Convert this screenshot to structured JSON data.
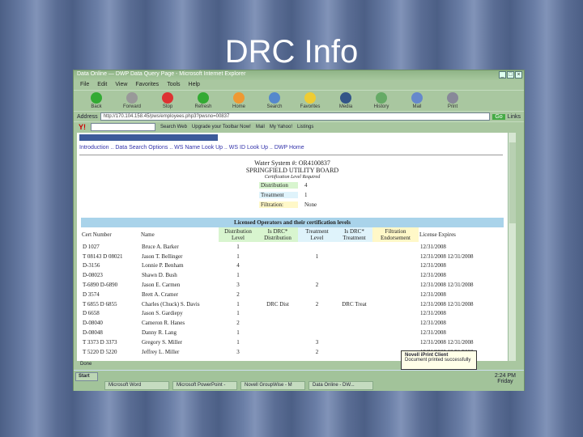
{
  "slide_title": "DRC Info",
  "window": {
    "title": "Data Online — DWP Data Query Page - Microsoft Internet Explorer",
    "menu": [
      "File",
      "Edit",
      "View",
      "Favorites",
      "Tools",
      "Help"
    ],
    "toolbar": [
      "Back",
      "Forward",
      "Stop",
      "Refresh",
      "Home",
      "Search",
      "Favorites",
      "Media",
      "History",
      "Mail",
      "Print"
    ],
    "address_label": "Address",
    "address": "http://170.104.158.45/pws/employees.php3?pwsno=00837",
    "go": "Go",
    "links": "Links",
    "yahoo": {
      "search_web": "Search Web",
      "upgrade": "Upgrade your Toolbar Now!",
      "mail": "Mail",
      "my_yahoo": "My Yahoo!",
      "listings": "Listings"
    },
    "status": "Done"
  },
  "page": {
    "nav": "Introduction .. Data Search Options .. WS Name Look Up .. WS ID Look Up .. DWP Home",
    "water_system": "Water System #: OR4100837",
    "name": "SPRINGFIELD UTILITY BOARD",
    "cert_required": "Certification Level Required",
    "requirements": [
      {
        "label": "Distribution",
        "value": "4",
        "color": "#d8f5cf"
      },
      {
        "label": "Treatment",
        "value": "1",
        "color": "#dff3fb"
      },
      {
        "label": "Filtration:",
        "value": "None",
        "color": "#fff8c8"
      }
    ],
    "table_caption": "Licensed Operators and their certification levels",
    "headers": [
      "Cert Number",
      "Name",
      "Distribution Level",
      "Is DRC* Distribution",
      "Treatment Level",
      "Is DRC* Treatment",
      "Filtration Endorsement",
      "License Expires"
    ],
    "rows": [
      [
        "D 1027",
        "Bruce A. Barker",
        "1",
        "",
        "",
        "",
        "",
        "12/31/2008"
      ],
      [
        "T 08143 D 08021",
        "Jason T. Bellinger",
        "1",
        "",
        "1",
        "",
        "",
        "12/31/2008 12/31/2008"
      ],
      [
        "D-3156",
        "Lonnie P. Benham",
        "4",
        "",
        "",
        "",
        "",
        "12/31/2008"
      ],
      [
        "D-08023",
        "Shawn D. Bush",
        "1",
        "",
        "",
        "",
        "",
        "12/31/2008"
      ],
      [
        "T-6890 D-6890",
        "Jason E. Carmen",
        "3",
        "",
        "2",
        "",
        "",
        "12/31/2008 12/31/2008"
      ],
      [
        "D 3574",
        "Brett A. Cramer",
        "2",
        "",
        "",
        "",
        "",
        "12/31/2008"
      ],
      [
        "T 6855 D 6855",
        "Charles (Chuck) S. Davis",
        "1",
        "DRC Dist",
        "2",
        "DRC Treat",
        "",
        "12/31/2008 12/31/2008"
      ],
      [
        "D 6658",
        "Jason S. Gardiepy",
        "1",
        "",
        "",
        "",
        "",
        "12/31/2008"
      ],
      [
        "D-08040",
        "Cameron R. Hanes",
        "2",
        "",
        "",
        "",
        "",
        "12/31/2008"
      ],
      [
        "D-08048",
        "Danny R. Lang",
        "1",
        "",
        "",
        "",
        "",
        "12/31/2008"
      ],
      [
        "T 3373 D 3373",
        "Gregory S. Miller",
        "1",
        "",
        "3",
        "",
        "",
        "12/31/2008 12/31/2008"
      ],
      [
        "T 5220 D 5220",
        "Jeffrey L. Miller",
        "3",
        "",
        "2",
        "",
        "",
        "12/31/2008 12/31/2008"
      ]
    ]
  },
  "balloon": {
    "title": "Novell iPrint Client",
    "text": "Document printed successfully"
  },
  "taskbar": {
    "start": "Start",
    "buttons": [
      "Microsoft Word",
      "Microsoft PowerPoint -",
      "Novell GroupWise - M",
      "Data Online - DW..."
    ],
    "time": "2:24 PM",
    "day": "Friday"
  }
}
